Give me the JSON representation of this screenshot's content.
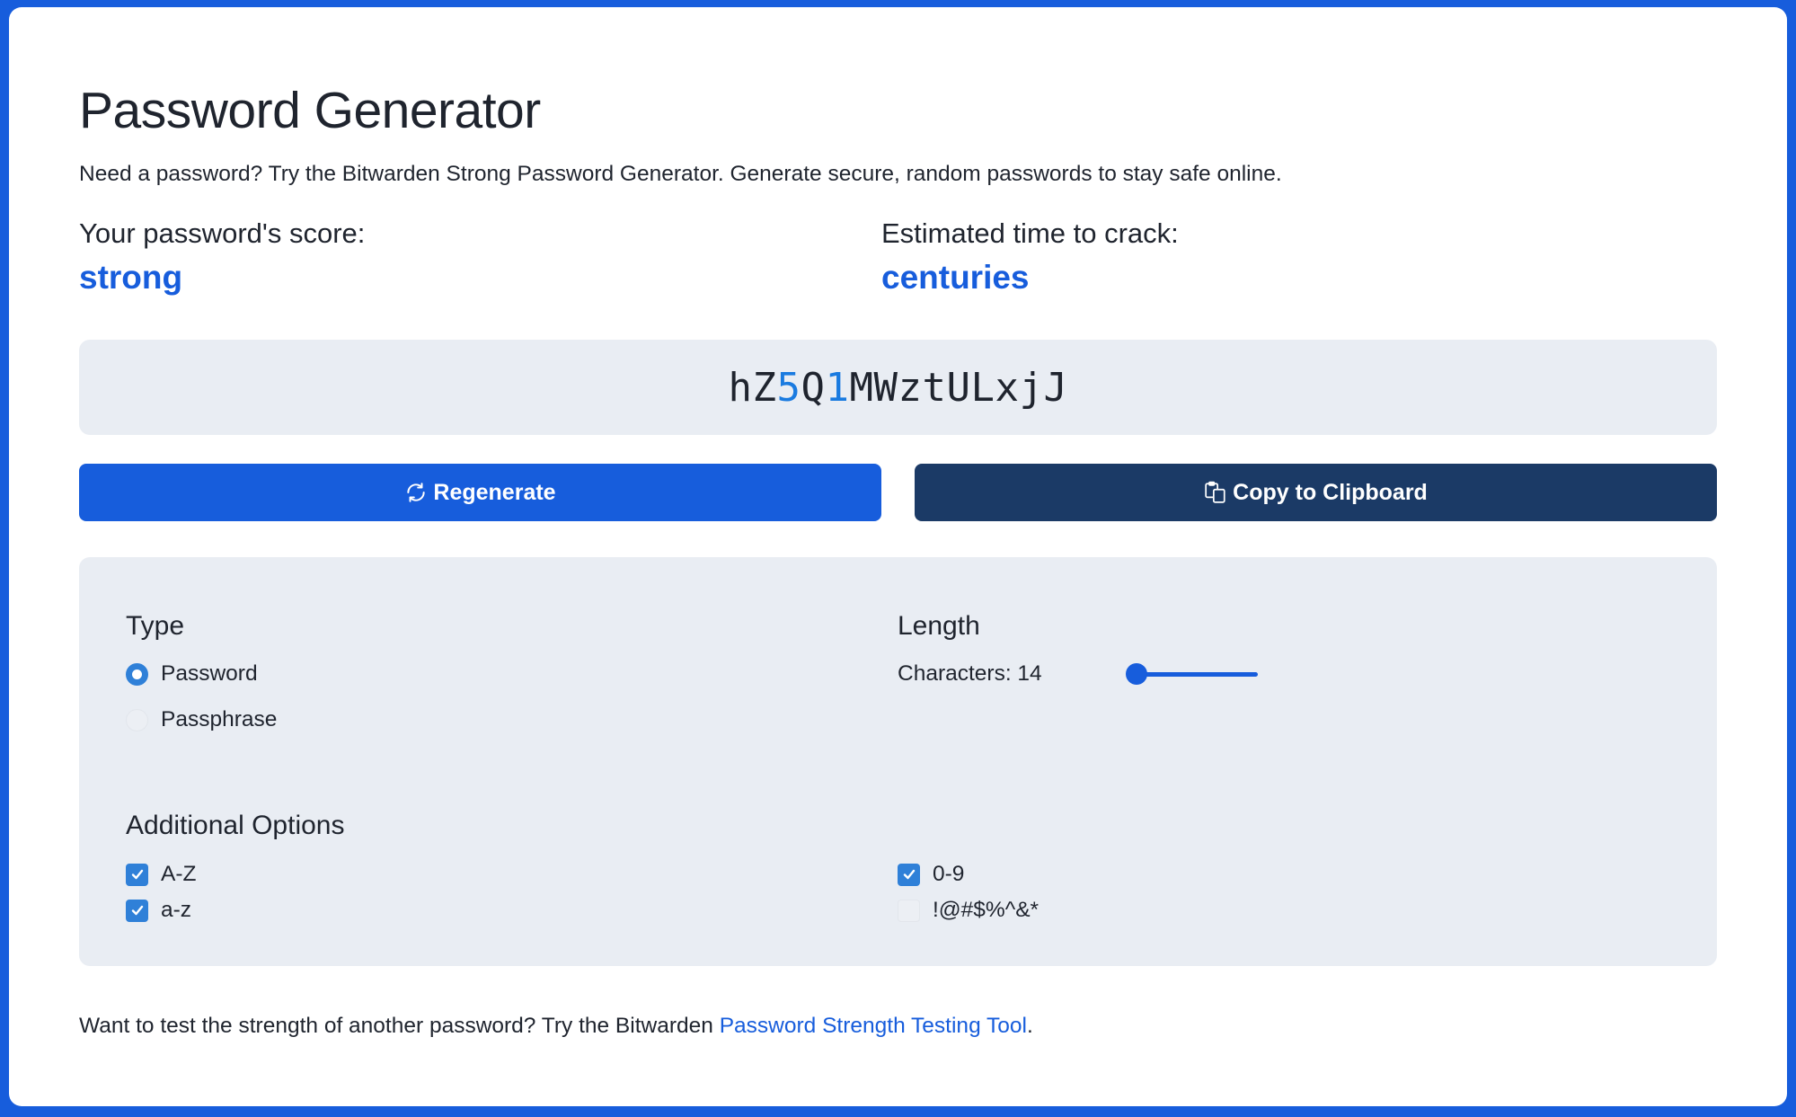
{
  "header": {
    "title": "Password Generator",
    "subtitle": "Need a password? Try the Bitwarden Strong Password Generator. Generate secure, random passwords to stay safe online."
  },
  "score": {
    "label": "Your password's score:",
    "value": "strong"
  },
  "crack_time": {
    "label": "Estimated time to crack:",
    "value": "centuries"
  },
  "password": {
    "value": "hZ5Q1MWztULxjJ",
    "segments": [
      {
        "text": "hZ",
        "type": "char"
      },
      {
        "text": "5",
        "type": "num"
      },
      {
        "text": "Q",
        "type": "char"
      },
      {
        "text": "1",
        "type": "num"
      },
      {
        "text": "MWztULxjJ",
        "type": "char"
      }
    ]
  },
  "buttons": {
    "regenerate": {
      "label": "Regenerate",
      "icon": "refresh-icon"
    },
    "copy": {
      "label": "Copy to Clipboard",
      "icon": "clipboard-copy-icon"
    }
  },
  "options": {
    "type": {
      "heading": "Type",
      "choices": [
        {
          "label": "Password",
          "selected": true
        },
        {
          "label": "Passphrase",
          "selected": false
        }
      ]
    },
    "length": {
      "heading": "Length",
      "label": "Characters: 14",
      "value": 14,
      "slider_fraction": 0.07
    },
    "additional": {
      "heading": "Additional Options",
      "checkboxes": [
        {
          "label": "A-Z",
          "checked": true
        },
        {
          "label": "a-z",
          "checked": true
        },
        {
          "label": "0-9",
          "checked": true
        },
        {
          "label": "!@#$%^&*",
          "checked": false
        }
      ]
    }
  },
  "footer": {
    "text": "Want to test the strength of another password? Try the Bitwarden ",
    "link_label": "Password Strength Testing Tool",
    "suffix": "."
  },
  "colors": {
    "brand_blue": "#175ddc",
    "navy": "#1b3a66",
    "panel_bg": "#e9edf3",
    "digit_blue": "#1a7be0"
  }
}
